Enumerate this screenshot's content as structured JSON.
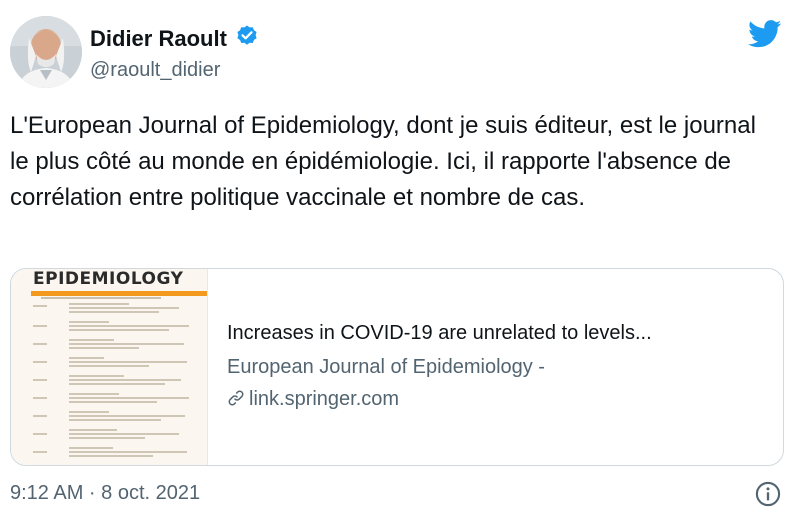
{
  "user": {
    "display_name": "Didier Raoult",
    "handle": "@raoult_didier",
    "verified": true,
    "avatar_icon": "profile-photo"
  },
  "brand": {
    "logo_icon": "twitter-bird-icon",
    "color": "#1d9bf0"
  },
  "tweet": {
    "text": "L'European Journal of Epidemiology, dont je suis éditeur, est le journal le plus côté au monde en épidémiologie. Ici, il rapporte l'absence de corrélation entre politique vaccinale et nombre de cas."
  },
  "card": {
    "thumbnail_title": "EPIDEMIOLOGY",
    "title": "Increases in COVID-19 are unrelated to levels...",
    "source": "European Journal of Epidemiology -",
    "domain": "link.springer.com",
    "accent": "#f39a1e"
  },
  "footer": {
    "timestamp": "9:12 AM · 8 oct. 2021",
    "info_icon": "info-icon"
  }
}
